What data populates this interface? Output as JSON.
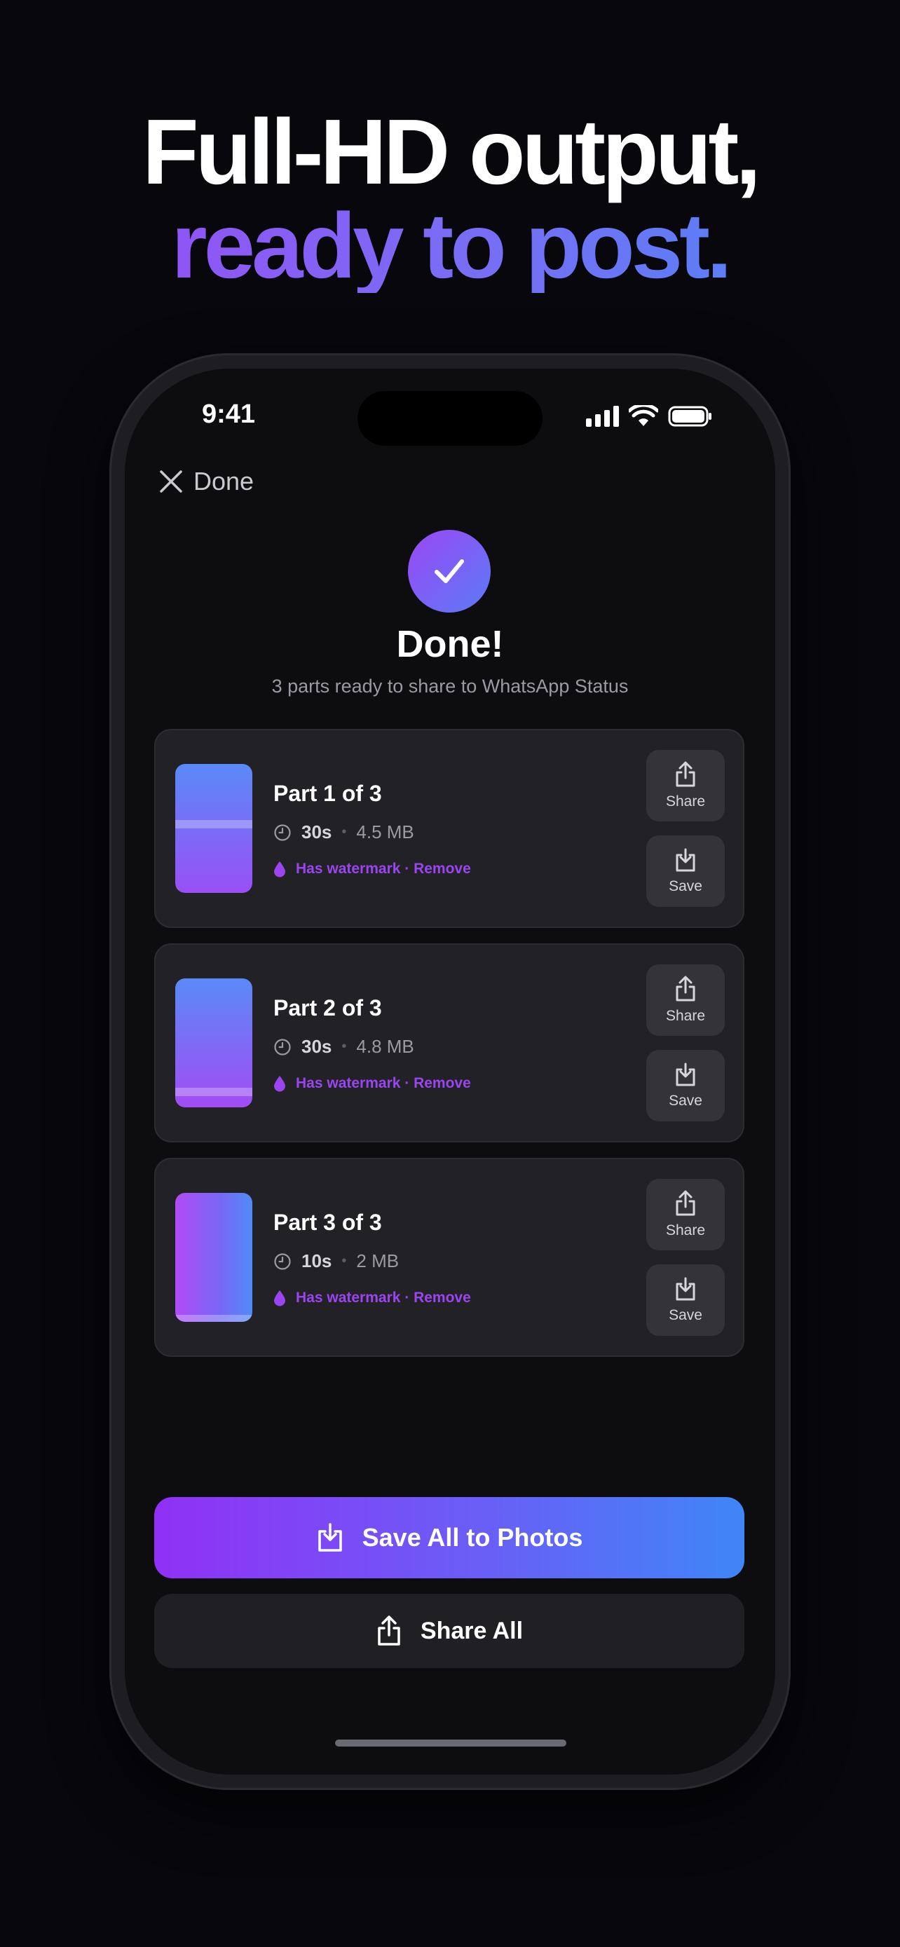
{
  "headline": {
    "line1": "Full-HD output,",
    "line2": "ready to post."
  },
  "status_bar": {
    "time": "9:41",
    "icons": [
      "cellular-signal-icon",
      "wifi-icon",
      "battery-icon"
    ]
  },
  "nav": {
    "close_label": "Done",
    "close_icon": "close-icon"
  },
  "success": {
    "icon": "checkmark-icon",
    "title": "Done!",
    "subtitle": "3 parts ready to share to WhatsApp Status"
  },
  "parts": [
    {
      "title": "Part 1 of 3",
      "duration": "30s",
      "size": "4.5 MB",
      "watermark_text": "Has watermark · Remove",
      "share_label": "Share",
      "save_label": "Save"
    },
    {
      "title": "Part 2 of 3",
      "duration": "30s",
      "size": "4.8 MB",
      "watermark_text": "Has watermark · Remove",
      "share_label": "Share",
      "save_label": "Save"
    },
    {
      "title": "Part 3 of 3",
      "duration": "10s",
      "size": "2 MB",
      "watermark_text": "Has watermark · Remove",
      "share_label": "Share",
      "save_label": "Save"
    }
  ],
  "actions": {
    "save_all_label": "Save All to Photos",
    "share_all_label": "Share All"
  },
  "colors": {
    "background": "#07070c",
    "accent_purple": "#9b47f5",
    "accent_blue": "#4a88f7",
    "card": "#222226",
    "watermark_text": "#9a45f0"
  }
}
